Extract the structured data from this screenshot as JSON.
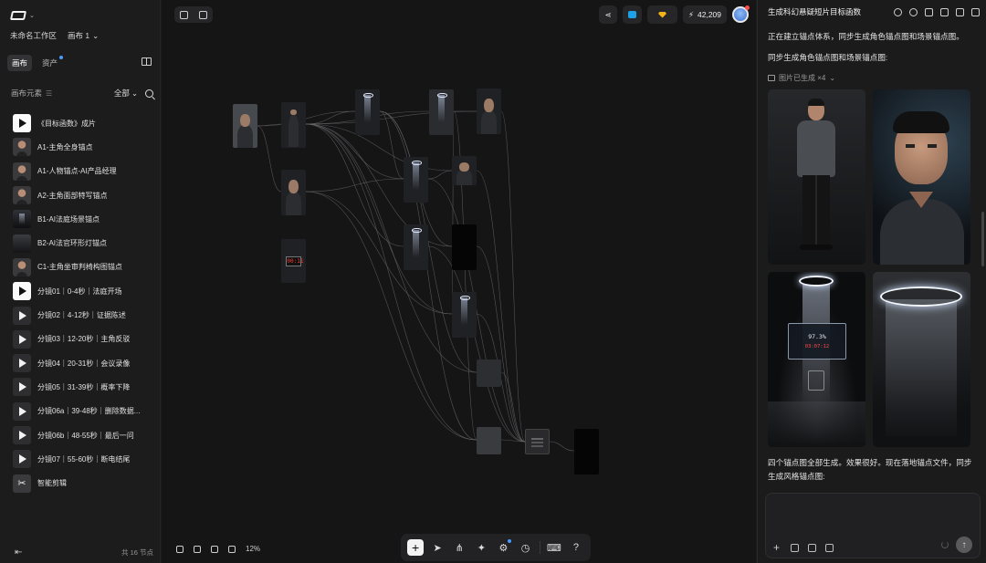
{
  "sidebar": {
    "workspace_name": "未命名工作区",
    "canvas_name": "画布 1",
    "tabs": [
      {
        "label": "画布",
        "active": true
      },
      {
        "label": "资产",
        "active": false,
        "has_dot": true
      }
    ],
    "elements_title": "画布元素",
    "filter_label": "全部",
    "items": [
      {
        "label": "《目标函数》成片",
        "thumb": "video"
      },
      {
        "label": "A1-主角全身锚点",
        "thumb": "person"
      },
      {
        "label": "A1-人物锚点-AI产品经理",
        "thumb": "person"
      },
      {
        "label": "A2-主角面部特写锚点",
        "thumb": "person"
      },
      {
        "label": "B1-AI法庭场景锚点",
        "thumb": "scene"
      },
      {
        "label": "B2-AI法官环形灯锚点",
        "thumb": "ring"
      },
      {
        "label": "C1-主角坐审判椅构图锚点",
        "thumb": "person"
      },
      {
        "label": "分镜01｜0-4秒｜法庭开场",
        "thumb": "video"
      },
      {
        "label": "分镜02｜4-12秒｜证据陈述",
        "thumb": "video-dark"
      },
      {
        "label": "分镜03｜12-20秒｜主角反驳",
        "thumb": "video-dark"
      },
      {
        "label": "分镜04｜20-31秒｜会议录像",
        "thumb": "video-dark"
      },
      {
        "label": "分镜05｜31-39秒｜概率下降",
        "thumb": "video-dark"
      },
      {
        "label": "分镜06a｜39-48秒｜删除数据...",
        "thumb": "video-dark"
      },
      {
        "label": "分镜06b｜48-55秒｜最后一问",
        "thumb": "video-dark"
      },
      {
        "label": "分镜07｜55-60秒｜断电结尾",
        "thumb": "video-dark"
      },
      {
        "label": "智能剪辑",
        "thumb": "scissors"
      }
    ],
    "node_count": "共 16 节点"
  },
  "canvas": {
    "credits": "42,209",
    "zoom": "12%",
    "clock_text": "00:11",
    "accent": "#4a9bff"
  },
  "chat": {
    "title": "生成科幻悬疑短片目标函数",
    "msg1": "正在建立锚点体系，同步生成角色锚点图和场景锚点图。",
    "msg2": "同步生成角色锚点图和场景锚点图:",
    "gen_tag": "图片已生成 ×4",
    "screen_pct": "97.3%",
    "screen_time": "03:07:12",
    "msg3": "四个锚点图全部生成。效果很好。现在落地锚点文件，同步生成风格锚点图:"
  }
}
